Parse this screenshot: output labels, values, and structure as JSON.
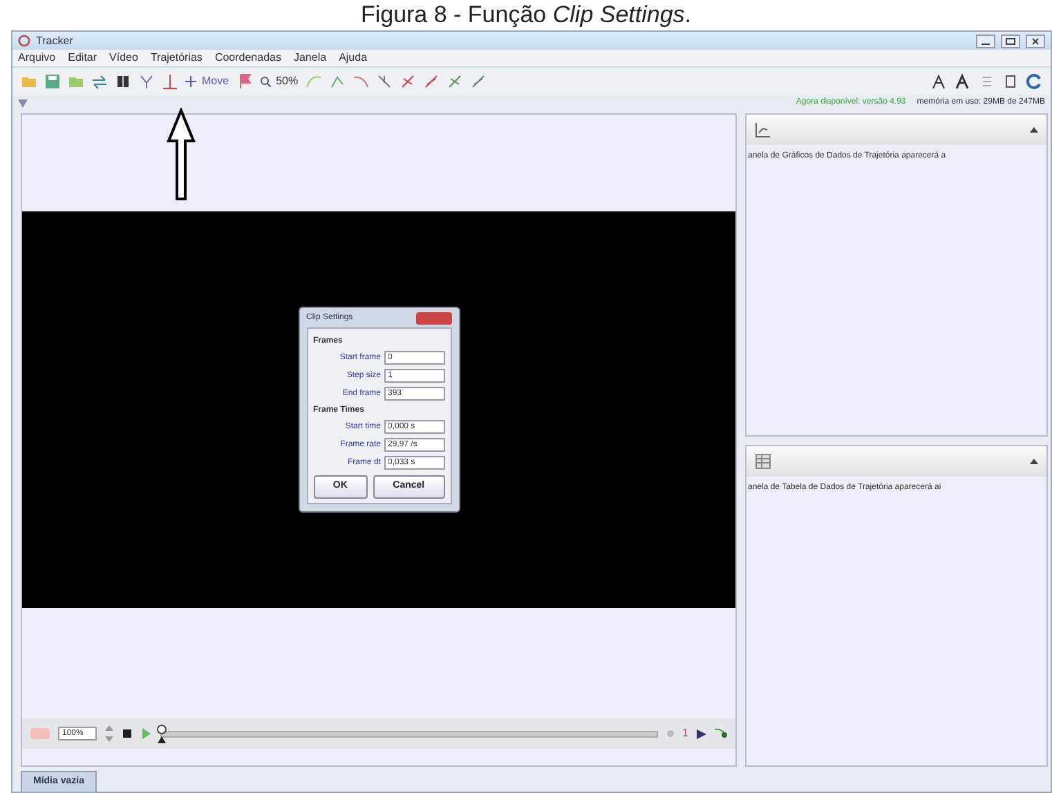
{
  "caption": "Figura 8 - Função *Clip Settings*.",
  "window": {
    "title": "Tracker"
  },
  "menu": [
    "Arquivo",
    "Editar",
    "Vídeo",
    "Trajetórias",
    "Coordenadas",
    "Janela",
    "Ajuda"
  ],
  "toolbar": {
    "move_label": "Move",
    "zoom_label": "50%"
  },
  "status": {
    "update": "Agora disponível: versão 4.93",
    "memory": "memória em uso: 29MB de 247MB"
  },
  "dialog": {
    "title": "Clip Settings",
    "sections": [
      {
        "title": "Frames",
        "fields": [
          {
            "label": "Start frame",
            "value": "0"
          },
          {
            "label": "Step size",
            "value": "1"
          },
          {
            "label": "End frame",
            "value": "393"
          }
        ]
      },
      {
        "title": "Frame Times",
        "fields": [
          {
            "label": "Start time",
            "value": "0,000 s"
          },
          {
            "label": "Frame rate",
            "value": "29,97 /s"
          },
          {
            "label": "Frame dt",
            "value": "0,033 s"
          }
        ]
      }
    ],
    "buttons": [
      "OK",
      "Cancel"
    ]
  },
  "panels": [
    {
      "kind": "plot",
      "message": "anela de Gráficos de Dados de Trajetória aparecerá a"
    },
    {
      "kind": "table",
      "message": "anela de Tabela de Dados de Trajetória aparecerá ai"
    }
  ],
  "player": {
    "zoom": "100%",
    "level": 0,
    "step": "1"
  },
  "tab": {
    "label": "Mídia vazia",
    "selected": true
  }
}
